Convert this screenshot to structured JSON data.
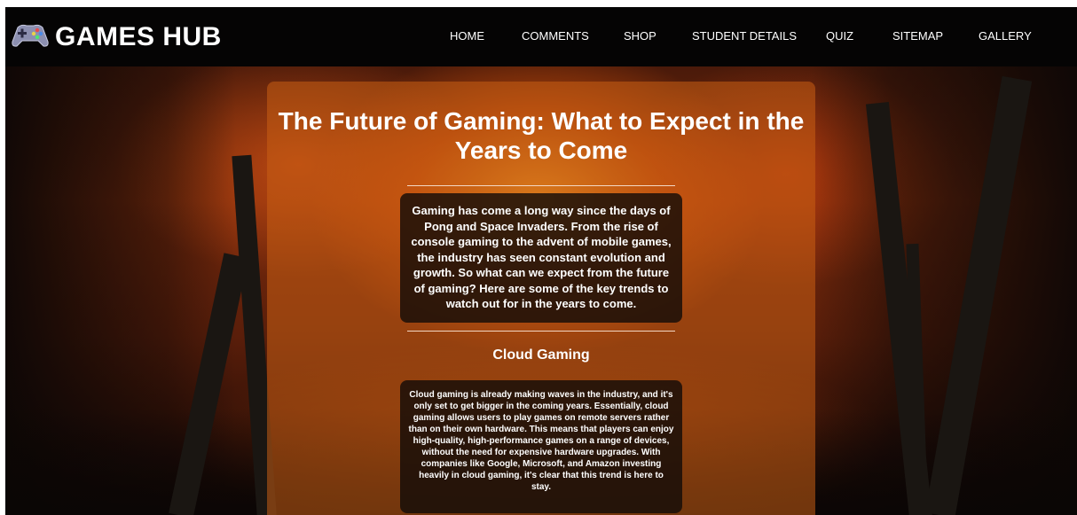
{
  "brand": {
    "icon": "gamepad-icon",
    "title": "GAMES HUB"
  },
  "nav": {
    "items": [
      {
        "label": "HOME"
      },
      {
        "label": "COMMENTS"
      },
      {
        "label": "SHOP"
      },
      {
        "label": "STUDENT DETAILS"
      },
      {
        "label": "QUIZ"
      },
      {
        "label": "SITEMAP"
      },
      {
        "label": "GALLERY"
      }
    ]
  },
  "article": {
    "title": "The Future of Gaming: What to Expect in the Years to Come",
    "intro": "Gaming has come a long way since the days of Pong and Space Invaders. From the rise of console gaming to the advent of mobile games, the industry has seen constant evolution and growth. So what can we expect from the future of gaming? Here are some of the key trends to watch out for in the years to come.",
    "sections": [
      {
        "heading": "Cloud Gaming",
        "body": "Cloud gaming is already making waves in the industry, and it's only set to get bigger in the coming years. Essentially, cloud gaming allows users to play games on remote servers rather than on their own hardware. This means that players can enjoy high-quality, high-performance games on a range of devices, without the need for expensive hardware upgrades. With companies like Google, Microsoft, and Amazon investing heavily in cloud gaming, it's clear that this trend is here to stay."
      }
    ]
  },
  "colors": {
    "navbar_bg": "#050404",
    "panel_bg": "#c85f14",
    "text_box_bg": "#140c08",
    "text": "#ffffff"
  }
}
